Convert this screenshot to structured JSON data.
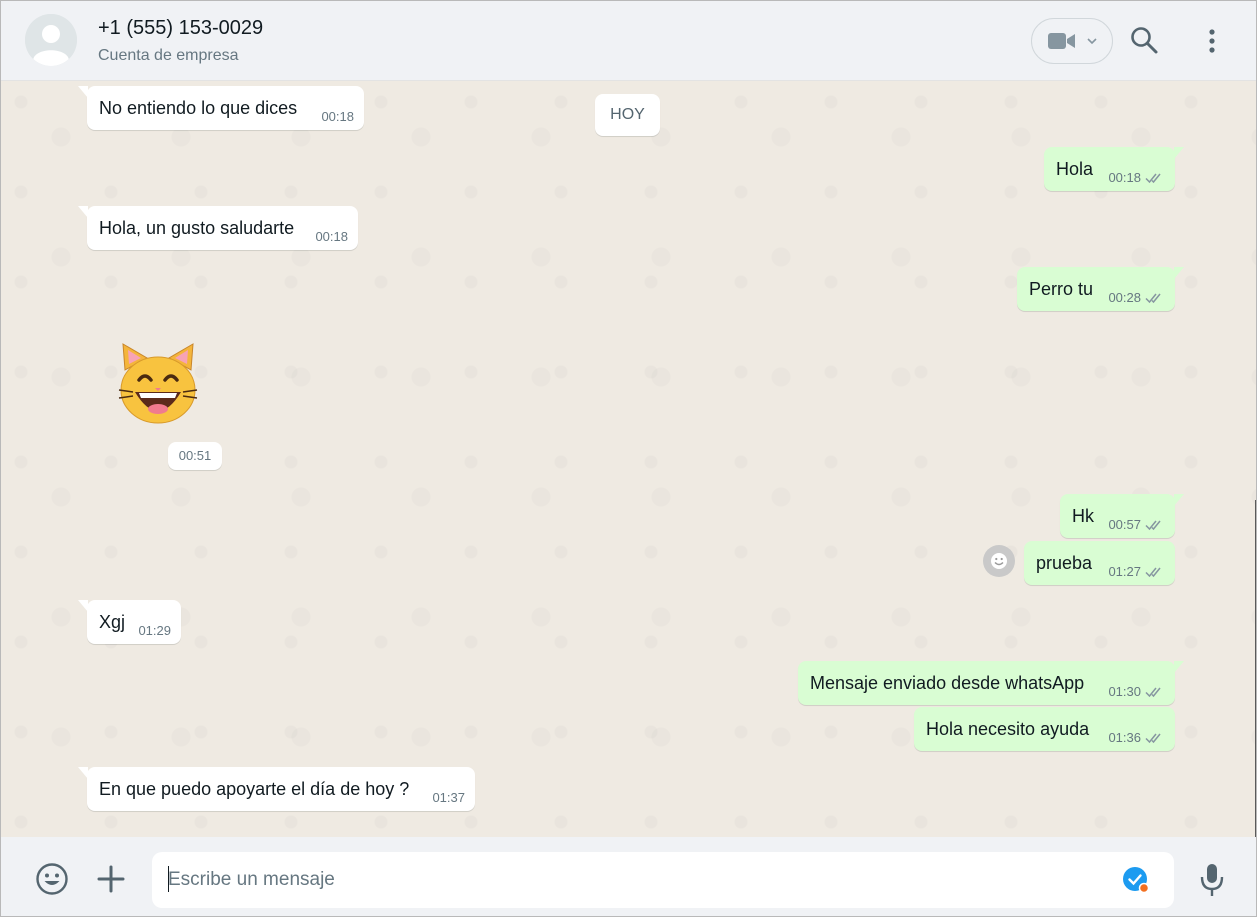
{
  "header": {
    "contact_name": "+1 (555) 153-0029",
    "contact_subtitle": "Cuenta de empresa",
    "icons": [
      "avatar-placeholder-icon",
      "video-call-icon",
      "chevron-down-icon",
      "search-icon",
      "kebab-menu-icon"
    ]
  },
  "chat": {
    "day_badge": "HOY",
    "messages": [
      {
        "dir": "in",
        "text": "No entiendo lo que dices",
        "time": "00:18"
      },
      {
        "dir": "out",
        "text": "Hola",
        "time": "00:18",
        "status": "read-double-tick"
      },
      {
        "dir": "in",
        "text": "Hola, un gusto saludarte",
        "time": "00:18"
      },
      {
        "dir": "out",
        "text": "Perro tu",
        "time": "00:28",
        "status": "read-double-tick"
      },
      {
        "dir": "in",
        "type": "sticker",
        "sticker": "grinning-cat-emoji",
        "time": "00:51"
      },
      {
        "dir": "out",
        "text": "Hk",
        "time": "00:57",
        "status": "read-double-tick"
      },
      {
        "dir": "out",
        "text": "prueba",
        "time": "01:27",
        "status": "read-double-tick"
      },
      {
        "dir": "in",
        "text": "Xgj",
        "time": "01:29"
      },
      {
        "dir": "out",
        "text": "Mensaje enviado desde whatsApp",
        "time": "01:30",
        "status": "read-double-tick"
      },
      {
        "dir": "out",
        "text": "Hola necesito ayuda",
        "time": "01:36",
        "status": "read-double-tick"
      },
      {
        "dir": "in",
        "text": "En que puedo apoyarte el día de hoy ?",
        "time": "01:37"
      }
    ]
  },
  "footer": {
    "placeholder": "Escribe un mensaje",
    "value": "",
    "icons": [
      "emoji-icon",
      "plus-icon",
      "extension-check-icon",
      "microphone-icon"
    ]
  },
  "colors": {
    "outgoing_bubble": "#d9fdd3",
    "incoming_bubble": "#ffffff",
    "chat_background": "#efeae2",
    "header_background": "#f0f2f5",
    "meta_text": "#667781",
    "accent_blue": "#1d9bf0"
  }
}
